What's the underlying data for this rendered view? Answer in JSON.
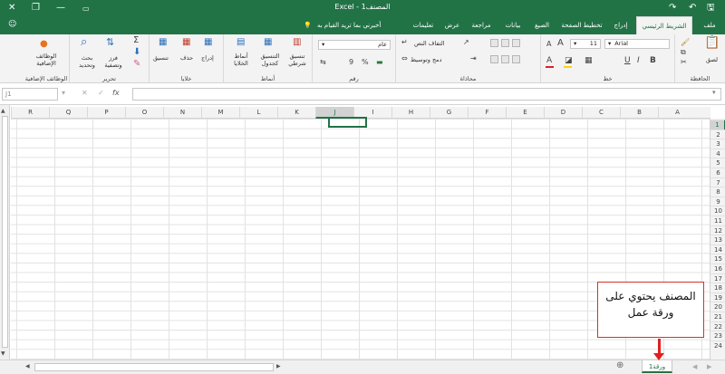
{
  "titlebar": {
    "title": "المصنف1 - Excel",
    "close": "✕",
    "restore": "❐",
    "minimize": "—",
    "user_icon": "user-icon",
    "save": "🖫",
    "undo": "↶",
    "redo": "↷"
  },
  "tabs": {
    "file": "ملف",
    "home": "الشريط الرئيسي",
    "insert": "إدراج",
    "page_layout": "تخطيط الصفحة",
    "formulas": "الصيغ",
    "data": "بيانات",
    "review": "مراجعة",
    "view": "عرض",
    "help": "تعليمات",
    "tell_me": "أخبرني بما تريد القيام به"
  },
  "ribbon": {
    "clipboard": {
      "label": "الحافظة",
      "paste": "لصق"
    },
    "font": {
      "label": "خط",
      "font_name": "Arial",
      "font_size": "11",
      "bold": "B",
      "italic": "I",
      "underline": "U",
      "color_red": "#e02020",
      "color_yellow": "#ffd400"
    },
    "alignment": {
      "label": "محاذاة",
      "wrap": "التفاف النص",
      "merge": "دمج وتوسيط"
    },
    "number": {
      "label": "رقم",
      "format": "عام",
      "percent": "%",
      "comma": "9"
    },
    "styles": {
      "label": "أنماط",
      "conditional": "تنسيق شرطي",
      "table": "التنسيق كجدول",
      "cell_styles": "أنماط الخلايا"
    },
    "cells": {
      "label": "خلايا",
      "insert": "إدراج",
      "delete": "حذف",
      "format": "تنسيق"
    },
    "editing": {
      "label": "تحرير",
      "sort": "فرز وتصفية",
      "find": "بحث وتحديد"
    },
    "addins": {
      "label": "الوظائف الإضافية",
      "button": "الوظائف الإضافية"
    }
  },
  "formula_bar": {
    "name_box": "J1",
    "cancel": "✕",
    "enter": "✓",
    "fx": "fx"
  },
  "grid": {
    "columns": [
      "R",
      "Q",
      "P",
      "O",
      "N",
      "M",
      "L",
      "K",
      "J",
      "I",
      "H",
      "G",
      "F",
      "E",
      "D",
      "C",
      "B",
      "A"
    ],
    "rows": [
      "1",
      "2",
      "3",
      "4",
      "5",
      "6",
      "7",
      "8",
      "9",
      "10",
      "11",
      "12",
      "13",
      "14",
      "15",
      "16",
      "17",
      "18",
      "19",
      "20",
      "21",
      "22",
      "23",
      "24"
    ],
    "active_cell": "J1"
  },
  "sheetbar": {
    "sheet_name": "ورقة1",
    "add_sheet": "⊕"
  },
  "callout": {
    "line1": "المصنف يحتوي على",
    "line2": "ورقة عمل"
  }
}
